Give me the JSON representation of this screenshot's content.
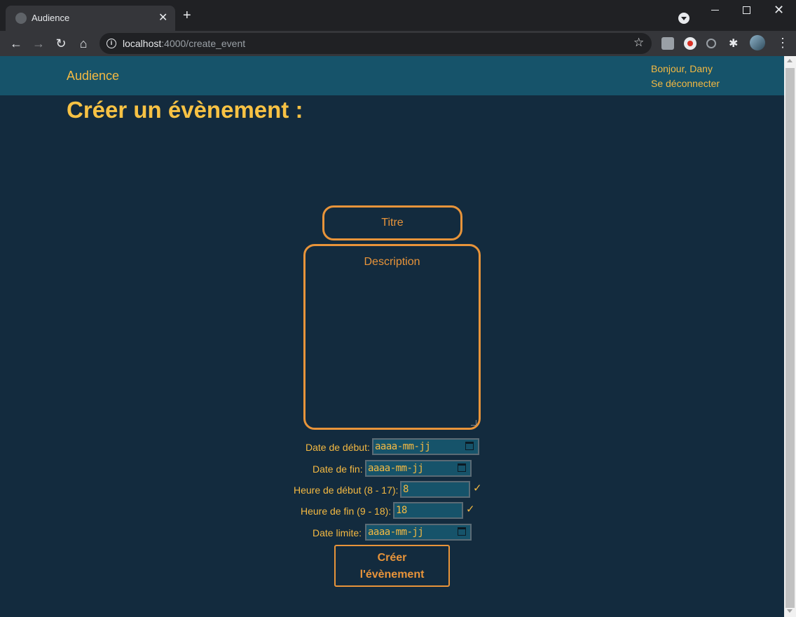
{
  "browser": {
    "tab_title": "Audience",
    "url_host": "localhost",
    "url_path": ":4000/create_event"
  },
  "navbar": {
    "brand": "Audience",
    "greeting": "Bonjour, Dany",
    "logout": "Se déconnecter"
  },
  "page": {
    "title": "Créer un évènement :"
  },
  "form": {
    "title_placeholder": "Titre",
    "description_placeholder": "Description",
    "start_date_label": "Date de début:",
    "start_date_value": "aaaa-mm-jj",
    "end_date_label": "Date de fin:",
    "end_date_value": "aaaa-mm-jj",
    "start_hour_label": "Heure de début (8 - 17):",
    "start_hour_value": "8",
    "end_hour_label": "Heure de fin (9 - 18):",
    "end_hour_value": "18",
    "deadline_label": "Date limite:",
    "deadline_value": "aaaa-mm-jj",
    "valid_mark": "✓",
    "submit_line1": "Créer",
    "submit_line2": "l'évènement"
  },
  "colors": {
    "navbar_bg": "#16536a",
    "page_bg": "#132b3e",
    "accent_gold": "#f4b942",
    "accent_orange": "#e8943a"
  }
}
